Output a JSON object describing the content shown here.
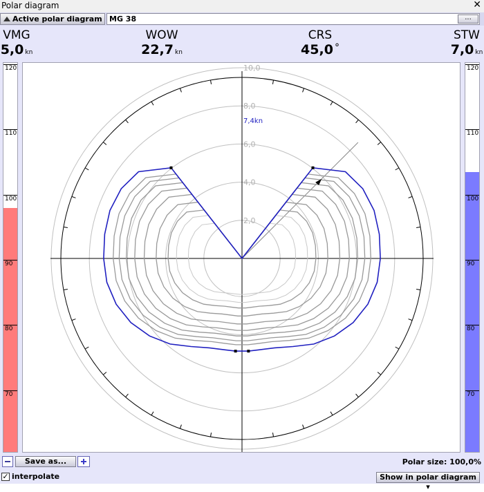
{
  "window": {
    "title": "Polar diagram",
    "close_glyph": "✕"
  },
  "toolbar": {
    "active_label": "Active polar diagram",
    "polar_name": "MG 38",
    "browse_label": "..."
  },
  "readouts": {
    "vmg": {
      "label": "VMG",
      "value": "5,0",
      "unit": "kn"
    },
    "wow": {
      "label": "WOW",
      "value": "22,7",
      "unit": "kn"
    },
    "crs": {
      "label": "CRS",
      "value": "45,0",
      "unit": "°"
    },
    "stw": {
      "label": "STW",
      "value": "7,0",
      "unit": "kn"
    }
  },
  "vmg_bar": {
    "ticks": [
      "120",
      "110",
      "100",
      "90",
      "80",
      "70"
    ],
    "fill_level": 0.627,
    "fill_color": "#ff7b7b"
  },
  "stw_bar": {
    "ticks": [
      "120",
      "110",
      "100",
      "90",
      "80",
      "70"
    ],
    "fill_level": 0.72,
    "fill_color": "#7b7bff"
  },
  "chart_data": {
    "type": "polar",
    "radial_labels": [
      "2,0",
      "4,0",
      "6,0",
      "8,0",
      "10,0"
    ],
    "highlight_label": "7,4kn",
    "colors": {
      "active_curve": "#2020c0",
      "curves": "#999999"
    }
  },
  "bottom": {
    "save_label": "Save as...",
    "polar_size": "Polar size: 100,0%",
    "interpolate_label": "interpolate",
    "show_label": "Show in polar diagram ▾"
  }
}
